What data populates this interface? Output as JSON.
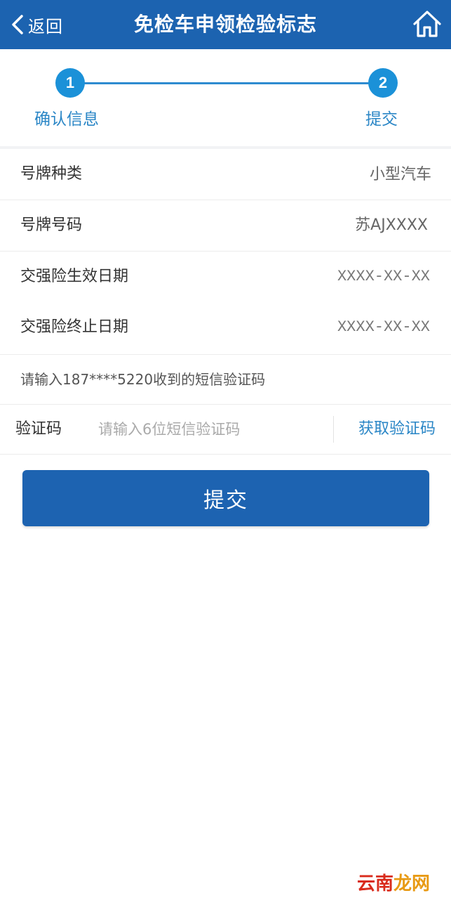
{
  "header": {
    "back_label": "返回",
    "title": "免检车申领检验标志",
    "bg_color": "#1c63b0"
  },
  "stepper": {
    "steps": [
      {
        "number": "1",
        "label": "确认信息"
      },
      {
        "number": "2",
        "label": "提交"
      }
    ],
    "accent_color": "#1b91d8"
  },
  "info": {
    "rows": [
      {
        "label": "号牌种类",
        "value": "小型汽车"
      },
      {
        "label": "号牌号码",
        "value": "苏AJXXXX"
      },
      {
        "label": "交强险生效日期",
        "value": "XXXX-XX-XX"
      },
      {
        "label": "交强险终止日期",
        "value": "XXXX-XX-XX"
      }
    ]
  },
  "sms": {
    "notice": "请输入187****5220收到的短信验证码",
    "code_label": "验证码",
    "code_placeholder": "请输入6位短信验证码",
    "code_value": "",
    "get_code_label": "获取验证码"
  },
  "submit": {
    "label": "提交",
    "color": "#1d63b1"
  },
  "watermark": {
    "text_part1": "云南",
    "text_part2": "龙网"
  }
}
